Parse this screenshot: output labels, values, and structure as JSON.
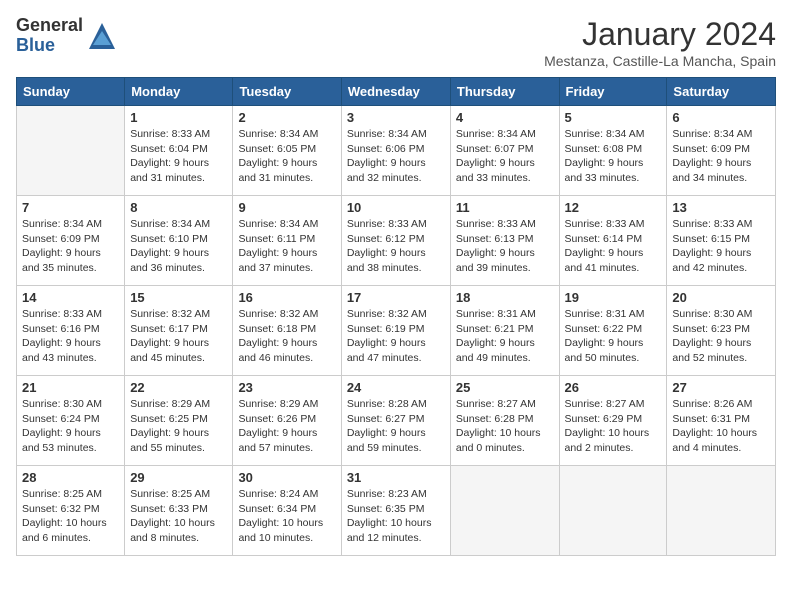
{
  "logo": {
    "general": "General",
    "blue": "Blue"
  },
  "title": "January 2024",
  "subtitle": "Mestanza, Castille-La Mancha, Spain",
  "days_of_week": [
    "Sunday",
    "Monday",
    "Tuesday",
    "Wednesday",
    "Thursday",
    "Friday",
    "Saturday"
  ],
  "weeks": [
    [
      {
        "day": "",
        "info": ""
      },
      {
        "day": "1",
        "info": "Sunrise: 8:33 AM\nSunset: 6:04 PM\nDaylight: 9 hours\nand 31 minutes."
      },
      {
        "day": "2",
        "info": "Sunrise: 8:34 AM\nSunset: 6:05 PM\nDaylight: 9 hours\nand 31 minutes."
      },
      {
        "day": "3",
        "info": "Sunrise: 8:34 AM\nSunset: 6:06 PM\nDaylight: 9 hours\nand 32 minutes."
      },
      {
        "day": "4",
        "info": "Sunrise: 8:34 AM\nSunset: 6:07 PM\nDaylight: 9 hours\nand 33 minutes."
      },
      {
        "day": "5",
        "info": "Sunrise: 8:34 AM\nSunset: 6:08 PM\nDaylight: 9 hours\nand 33 minutes."
      },
      {
        "day": "6",
        "info": "Sunrise: 8:34 AM\nSunset: 6:09 PM\nDaylight: 9 hours\nand 34 minutes."
      }
    ],
    [
      {
        "day": "7",
        "info": "Sunrise: 8:34 AM\nSunset: 6:09 PM\nDaylight: 9 hours\nand 35 minutes."
      },
      {
        "day": "8",
        "info": "Sunrise: 8:34 AM\nSunset: 6:10 PM\nDaylight: 9 hours\nand 36 minutes."
      },
      {
        "day": "9",
        "info": "Sunrise: 8:34 AM\nSunset: 6:11 PM\nDaylight: 9 hours\nand 37 minutes."
      },
      {
        "day": "10",
        "info": "Sunrise: 8:33 AM\nSunset: 6:12 PM\nDaylight: 9 hours\nand 38 minutes."
      },
      {
        "day": "11",
        "info": "Sunrise: 8:33 AM\nSunset: 6:13 PM\nDaylight: 9 hours\nand 39 minutes."
      },
      {
        "day": "12",
        "info": "Sunrise: 8:33 AM\nSunset: 6:14 PM\nDaylight: 9 hours\nand 41 minutes."
      },
      {
        "day": "13",
        "info": "Sunrise: 8:33 AM\nSunset: 6:15 PM\nDaylight: 9 hours\nand 42 minutes."
      }
    ],
    [
      {
        "day": "14",
        "info": "Sunrise: 8:33 AM\nSunset: 6:16 PM\nDaylight: 9 hours\nand 43 minutes."
      },
      {
        "day": "15",
        "info": "Sunrise: 8:32 AM\nSunset: 6:17 PM\nDaylight: 9 hours\nand 45 minutes."
      },
      {
        "day": "16",
        "info": "Sunrise: 8:32 AM\nSunset: 6:18 PM\nDaylight: 9 hours\nand 46 minutes."
      },
      {
        "day": "17",
        "info": "Sunrise: 8:32 AM\nSunset: 6:19 PM\nDaylight: 9 hours\nand 47 minutes."
      },
      {
        "day": "18",
        "info": "Sunrise: 8:31 AM\nSunset: 6:21 PM\nDaylight: 9 hours\nand 49 minutes."
      },
      {
        "day": "19",
        "info": "Sunrise: 8:31 AM\nSunset: 6:22 PM\nDaylight: 9 hours\nand 50 minutes."
      },
      {
        "day": "20",
        "info": "Sunrise: 8:30 AM\nSunset: 6:23 PM\nDaylight: 9 hours\nand 52 minutes."
      }
    ],
    [
      {
        "day": "21",
        "info": "Sunrise: 8:30 AM\nSunset: 6:24 PM\nDaylight: 9 hours\nand 53 minutes."
      },
      {
        "day": "22",
        "info": "Sunrise: 8:29 AM\nSunset: 6:25 PM\nDaylight: 9 hours\nand 55 minutes."
      },
      {
        "day": "23",
        "info": "Sunrise: 8:29 AM\nSunset: 6:26 PM\nDaylight: 9 hours\nand 57 minutes."
      },
      {
        "day": "24",
        "info": "Sunrise: 8:28 AM\nSunset: 6:27 PM\nDaylight: 9 hours\nand 59 minutes."
      },
      {
        "day": "25",
        "info": "Sunrise: 8:27 AM\nSunset: 6:28 PM\nDaylight: 10 hours\nand 0 minutes."
      },
      {
        "day": "26",
        "info": "Sunrise: 8:27 AM\nSunset: 6:29 PM\nDaylight: 10 hours\nand 2 minutes."
      },
      {
        "day": "27",
        "info": "Sunrise: 8:26 AM\nSunset: 6:31 PM\nDaylight: 10 hours\nand 4 minutes."
      }
    ],
    [
      {
        "day": "28",
        "info": "Sunrise: 8:25 AM\nSunset: 6:32 PM\nDaylight: 10 hours\nand 6 minutes."
      },
      {
        "day": "29",
        "info": "Sunrise: 8:25 AM\nSunset: 6:33 PM\nDaylight: 10 hours\nand 8 minutes."
      },
      {
        "day": "30",
        "info": "Sunrise: 8:24 AM\nSunset: 6:34 PM\nDaylight: 10 hours\nand 10 minutes."
      },
      {
        "day": "31",
        "info": "Sunrise: 8:23 AM\nSunset: 6:35 PM\nDaylight: 10 hours\nand 12 minutes."
      },
      {
        "day": "",
        "info": ""
      },
      {
        "day": "",
        "info": ""
      },
      {
        "day": "",
        "info": ""
      }
    ]
  ]
}
